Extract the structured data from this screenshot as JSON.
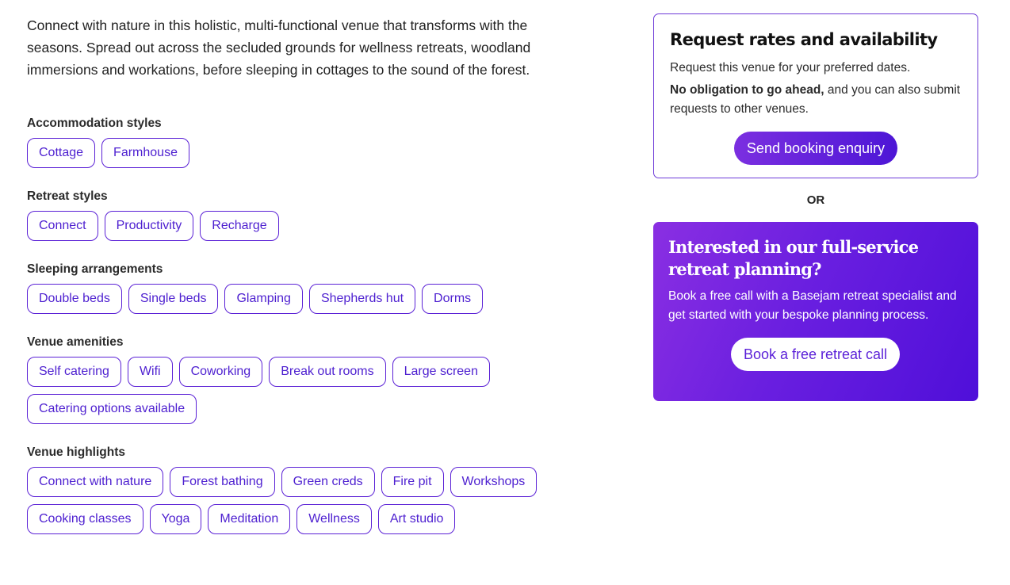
{
  "intro": "Connect with nature in this holistic, multi-functional venue that transforms with the seasons. Spread out across the secluded grounds for wellness retreats, woodland immersions and workations, before sleeping in cottages to the sound of the forest.",
  "sections": [
    {
      "title": "Accommodation styles",
      "tags": [
        "Cottage",
        "Farmhouse"
      ]
    },
    {
      "title": "Retreat styles",
      "tags": [
        "Connect",
        "Productivity",
        "Recharge"
      ]
    },
    {
      "title": "Sleeping arrangements",
      "tags": [
        "Double beds",
        "Single beds",
        "Glamping",
        "Shepherds hut",
        "Dorms"
      ]
    },
    {
      "title": "Venue amenities",
      "tags": [
        "Self catering",
        "Wifi",
        "Coworking",
        "Break out rooms",
        "Large screen",
        "Catering options available"
      ]
    },
    {
      "title": "Venue highlights",
      "tags": [
        "Connect with nature",
        "Forest bathing",
        "Green creds",
        "Fire pit",
        "Workshops",
        "Cooking classes",
        "Yoga",
        "Meditation",
        "Wellness",
        "Art studio"
      ]
    }
  ],
  "booking": {
    "title": "Request rates and availability",
    "line1": "Request this venue for your preferred dates.",
    "line2_bold": "No obligation to go ahead,",
    "line2_rest": " and you can also submit requests to other venues.",
    "button": "Send booking enquiry"
  },
  "or_label": "OR",
  "promo": {
    "title": "Interested in our full-service retreat planning?",
    "body": "Book a free call with a Basejam retreat specialist and get started with your bespoke planning process.",
    "button": "Book a free retreat call"
  },
  "colors": {
    "accent": "#5b21d6",
    "promo_gradient_start": "#8a2fe2",
    "promo_gradient_end": "#4f0fd9"
  }
}
